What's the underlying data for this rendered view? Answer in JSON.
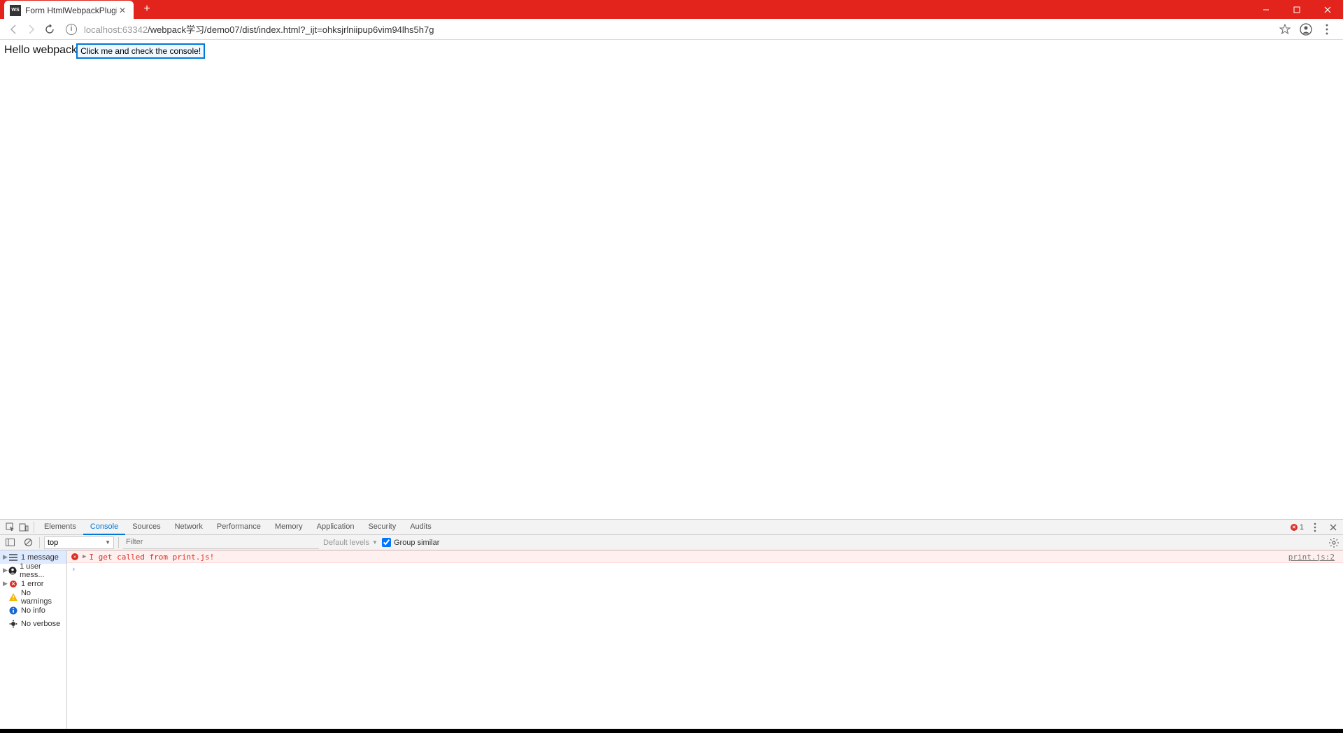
{
  "browser": {
    "tab_title": "Form HtmlWebpackPlugin",
    "url_host": "localhost:",
    "url_port": "63342",
    "url_path": "/webpack学习/demo07/dist/index.html?_ijt=ohksjrlniipup6vim94lhs5h7g",
    "favicon": "WS"
  },
  "page": {
    "hello": "Hello webpack",
    "button": "Click me and check the console!"
  },
  "devtools": {
    "tabs": [
      "Elements",
      "Console",
      "Sources",
      "Network",
      "Performance",
      "Memory",
      "Application",
      "Security",
      "Audits"
    ],
    "active_tab": "Console",
    "error_count": "1",
    "toolbar": {
      "context": "top",
      "filter_placeholder": "Filter",
      "level": "Default levels",
      "group_similar": "Group similar"
    },
    "sidebar": {
      "messages": "1 message",
      "user": "1 user mess...",
      "errors": "1 error",
      "warnings": "No warnings",
      "info": "No info",
      "verbose": "No verbose"
    },
    "console": {
      "message": "I get called from print.js!",
      "source": "print.js:2"
    }
  }
}
